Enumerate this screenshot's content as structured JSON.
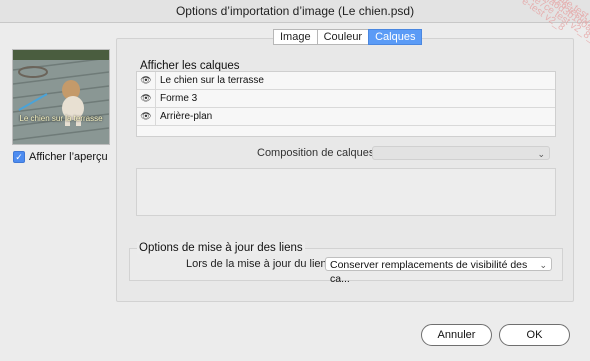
{
  "window": {
    "title": "Options d’importation d’image (Le chien.psd)"
  },
  "watermark": [
    "e-test v2_8",
    "ae7ce test v2_8_",
    "1ffa6d3b1d0ade0",
    "f1c6-test v2_8",
    "itte test v2_8_ffa6d3"
  ],
  "tabs": [
    {
      "label": "Image",
      "active": false
    },
    {
      "label": "Couleur",
      "active": false
    },
    {
      "label": "Calques",
      "active": true
    }
  ],
  "preview": {
    "caption": "Le chien sur la terrasse",
    "show_preview_label": "Afficher l’aperçu",
    "show_preview_checked": true
  },
  "layers_section": {
    "title": "Afficher les calques",
    "layers": [
      {
        "name": "Le chien sur la terrasse",
        "icon": "eye-icon"
      },
      {
        "name": "Forme 3",
        "icon": "eye-icon"
      },
      {
        "name": "Arrière-plan",
        "icon": "eye-icon"
      }
    ],
    "composition_label": "Composition de calques :",
    "composition_value": ""
  },
  "links_section": {
    "title": "Options de mise à jour des liens",
    "update_label": "Lors de la mise à jour du lien :",
    "update_value": "Conserver remplacements de visibilité des ca..."
  },
  "buttons": {
    "cancel": "Annuler",
    "ok": "OK"
  },
  "colors": {
    "accent": "#5b9bf6",
    "background": "#ececec"
  }
}
